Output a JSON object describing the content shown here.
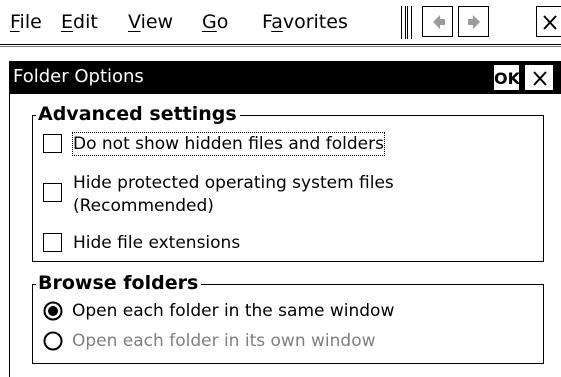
{
  "menubar": {
    "items": [
      {
        "pre": "",
        "key": "F",
        "post": "ile"
      },
      {
        "pre": "",
        "key": "E",
        "post": "dit"
      },
      {
        "pre": "",
        "key": "V",
        "post": "iew"
      },
      {
        "pre": "",
        "key": "G",
        "post": "o"
      },
      {
        "pre": "F",
        "key": "a",
        "post": "vorites"
      }
    ],
    "back_icon": "left-arrow-icon",
    "forward_icon": "right-arrow-icon",
    "close_icon": "close-icon"
  },
  "dialog": {
    "title": "Folder Options",
    "ok_label": "OK",
    "close_icon": "close-icon"
  },
  "advanced": {
    "legend": "Advanced settings",
    "options": [
      {
        "lines": [
          "Do not show hidden files and folders"
        ],
        "checked": false,
        "focused": true
      },
      {
        "lines": [
          "Hide protected operating system files",
          "(Recommended)"
        ],
        "checked": false,
        "focused": false
      },
      {
        "lines": [
          "Hide file extensions"
        ],
        "checked": false,
        "focused": false
      }
    ]
  },
  "browse": {
    "legend": "Browse folders",
    "options": [
      {
        "label": "Open each folder in the same window",
        "selected": true,
        "enabled": true
      },
      {
        "label": "Open each folder in its own window",
        "selected": false,
        "enabled": false
      }
    ]
  }
}
